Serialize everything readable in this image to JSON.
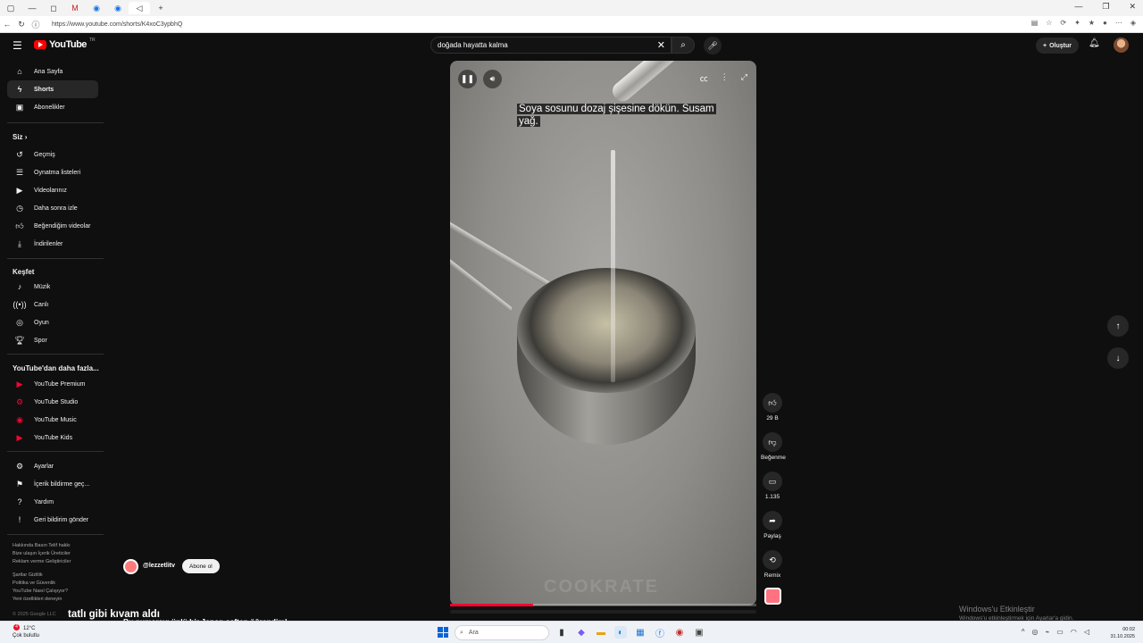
{
  "browser": {
    "url": "https://www.youtube.com/shorts/K4xoC3ypbhQ",
    "tabs": [
      "▢",
      "—",
      "◻",
      "M",
      "◉",
      "◉",
      "◁"
    ],
    "new_tab": "+"
  },
  "masthead": {
    "logo_text": "YouTube",
    "country_code": "TR",
    "search_value": "doğada hayatta kalma",
    "create_label": "Oluştur"
  },
  "sidebar": {
    "main": [
      {
        "label": "Ana Sayfa",
        "icon": "home-icon"
      },
      {
        "label": "Shorts",
        "icon": "shorts-icon"
      },
      {
        "label": "Abonelikler",
        "icon": "subscriptions-icon"
      }
    ],
    "you_header": "Siz",
    "you": [
      {
        "label": "Geçmiş",
        "icon": "history-icon"
      },
      {
        "label": "Oynatma listeleri",
        "icon": "playlists-icon"
      },
      {
        "label": "Videolarınız",
        "icon": "your-videos-icon"
      },
      {
        "label": "Daha sonra izle",
        "icon": "watch-later-icon"
      },
      {
        "label": "Beğendiğim videolar",
        "icon": "liked-icon"
      },
      {
        "label": "İndirilenler",
        "icon": "download-icon"
      }
    ],
    "explore_header": "Keşfet",
    "explore": [
      {
        "label": "Müzik",
        "icon": "music-icon"
      },
      {
        "label": "Canlı",
        "icon": "live-icon"
      },
      {
        "label": "Oyun",
        "icon": "gaming-icon"
      },
      {
        "label": "Spor",
        "icon": "trophy-icon"
      }
    ],
    "more_header": "YouTube'dan daha fazla...",
    "more": [
      {
        "label": "YouTube Premium",
        "icon": "youtube-premium-icon"
      },
      {
        "label": "YouTube Studio",
        "icon": "youtube-studio-icon"
      },
      {
        "label": "YouTube Music",
        "icon": "youtube-music-icon"
      },
      {
        "label": "YouTube Kids",
        "icon": "youtube-kids-icon"
      }
    ],
    "settings": [
      {
        "label": "Ayarlar",
        "icon": "gear-icon"
      },
      {
        "label": "İçerik bildirme geç...",
        "icon": "flag-icon"
      },
      {
        "label": "Yardım",
        "icon": "help-icon"
      },
      {
        "label": "Geri bildirim gönder",
        "icon": "feedback-icon"
      }
    ],
    "footer1": "Hakkında  Basın  Telif hakkı",
    "footer2": "Bize ulaşın  İçerik Üreticiler",
    "footer3": "Reklam verme  Geliştiriciler",
    "footer4": "Şartlar  Gizlilik",
    "footer5": "Politika ve Güvenlik",
    "footer6": "YouTube Nasıl Çalışıyor?",
    "footer7": "Yeni özellikleri deneyin",
    "copyright": "© 2025 Google LLC"
  },
  "player": {
    "caption": "Soya sosunu dozaj şişesine dökün. Susam yağ.",
    "watermark": "COOKRATE",
    "progress": 0.27
  },
  "actions": {
    "like_count": "29 B",
    "dislike_label": "Beğenme",
    "comment_count": "1.135",
    "share_label": "Paylaş",
    "remix_label": "Remix"
  },
  "video_info": {
    "channel": "@lezzetlitv",
    "subscribe_label": "Abone ol",
    "title_partial": "tatlı gibi kıvam aldı",
    "description": "Bu numarayı ünlü bir Japon şeften öğrendim!"
  },
  "windows_watermark": {
    "title": "Windows'u Etkinleştir",
    "subtitle": "Windows'u etkinleştirmek için Ayarlar'a gidin."
  },
  "taskbar": {
    "temperature": "12°C",
    "weather": "Çok bulutlu",
    "weather_badge": "4",
    "search_placeholder": "Ara",
    "time": "00:02",
    "date": "31.10.2025"
  }
}
